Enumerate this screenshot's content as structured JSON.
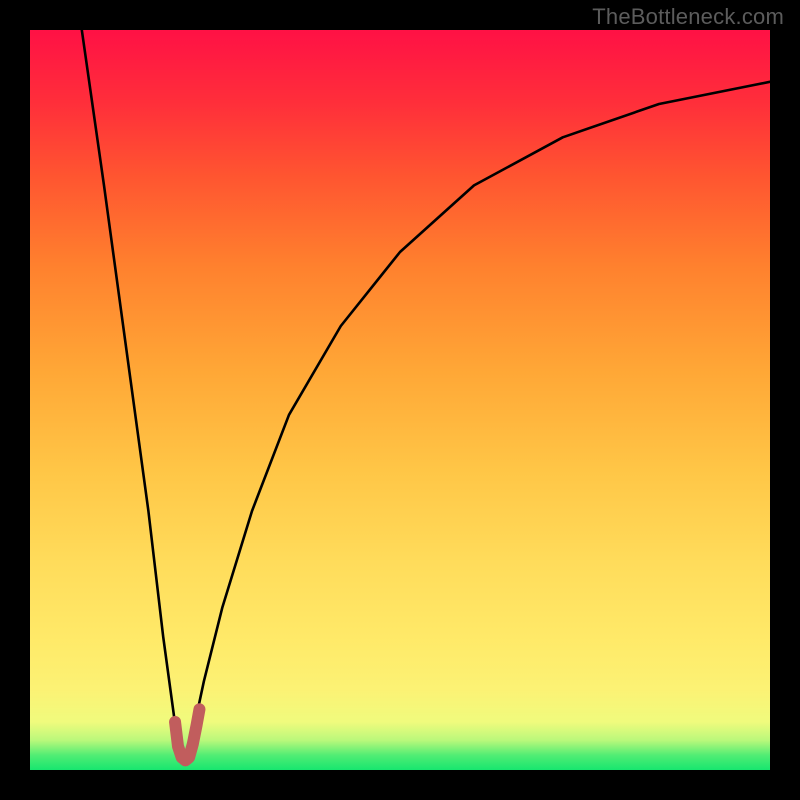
{
  "watermark": "TheBottleneck.com",
  "chart_data": {
    "type": "line",
    "title": "",
    "xlabel": "",
    "ylabel": "",
    "xlim": [
      0,
      100
    ],
    "ylim": [
      0,
      100
    ],
    "series": [
      {
        "name": "bottleneck-curve",
        "x": [
          7,
          10,
          13,
          16,
          18,
          19.5,
          20.5,
          21,
          21.5,
          22,
          23.5,
          26,
          30,
          35,
          42,
          50,
          60,
          72,
          85,
          100
        ],
        "values": [
          100,
          79,
          57,
          35,
          18,
          7,
          2,
          1,
          2,
          5,
          12,
          22,
          35,
          48,
          60,
          70,
          79,
          85.5,
          90,
          93
        ]
      },
      {
        "name": "valley-marker",
        "x": [
          19.6,
          20.0,
          20.5,
          21.0,
          21.5,
          22.0,
          22.5,
          22.9
        ],
        "values": [
          6.5,
          3.2,
          1.7,
          1.3,
          1.7,
          3.5,
          6.0,
          8.2
        ]
      }
    ],
    "colors": {
      "curve": "#000000",
      "marker": "#c15d5d"
    }
  }
}
